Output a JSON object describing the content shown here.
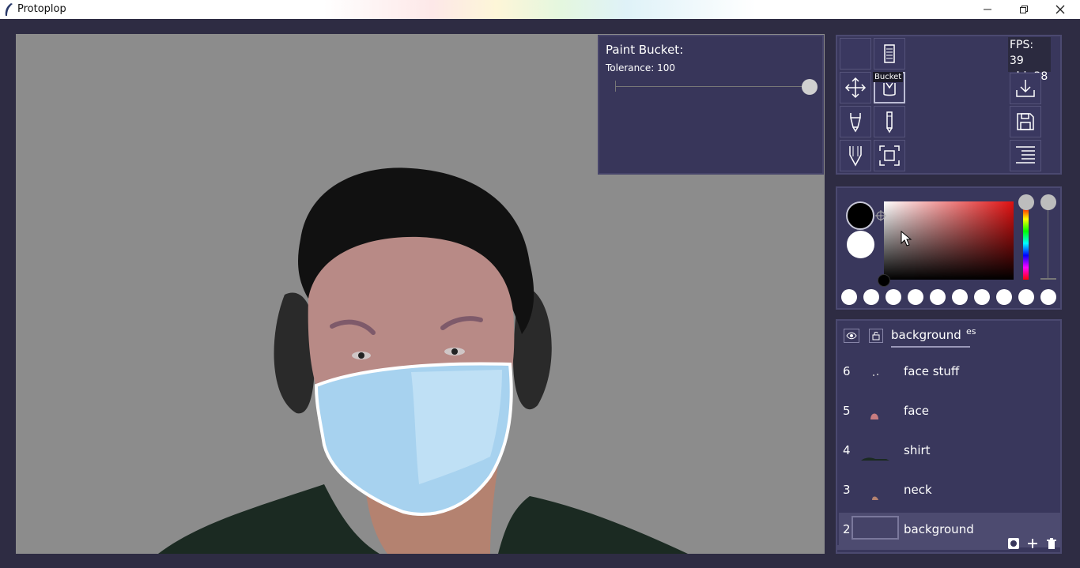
{
  "window": {
    "title": "Protoplop",
    "minimize_icon": "minimize-icon",
    "maximize_icon": "restore-icon",
    "close_icon": "close-icon"
  },
  "tool_options": {
    "title": "Paint Bucket:",
    "tolerance_label": "Tolerance: 100",
    "tolerance": 100,
    "tolerance_max": 100
  },
  "tools": {
    "tooltip": "Bucket",
    "items": [
      {
        "name": "empty-slot",
        "icon": "none"
      },
      {
        "name": "marker",
        "icon": "marker-icon"
      },
      {
        "name": "move",
        "icon": "move-icon"
      },
      {
        "name": "bucket",
        "icon": "bucket-icon",
        "active": true
      },
      {
        "name": "pen",
        "icon": "pen-icon"
      },
      {
        "name": "pencil",
        "icon": "pencil-icon"
      },
      {
        "name": "brush",
        "icon": "brush-icon"
      },
      {
        "name": "fit",
        "icon": "fit-screen-icon"
      }
    ],
    "actions": [
      {
        "name": "import",
        "icon": "download-icon"
      },
      {
        "name": "save",
        "icon": "save-icon"
      },
      {
        "name": "menu",
        "icon": "menu-icon"
      }
    ]
  },
  "stats": {
    "fps": "FPS: 39",
    "obj": "obj: 38"
  },
  "colors": {
    "primary": "#000000",
    "secondary": "#ffffff",
    "hue": "#e01010",
    "palette_count": 10
  },
  "layers": {
    "header_name": "background",
    "header_suffix": "es",
    "items": [
      {
        "num": "6",
        "name": "face stuff"
      },
      {
        "num": "5",
        "name": "face"
      },
      {
        "num": "4",
        "name": "shirt"
      },
      {
        "num": "3",
        "name": "neck"
      },
      {
        "num": "2",
        "name": "background",
        "selected": true
      }
    ]
  }
}
